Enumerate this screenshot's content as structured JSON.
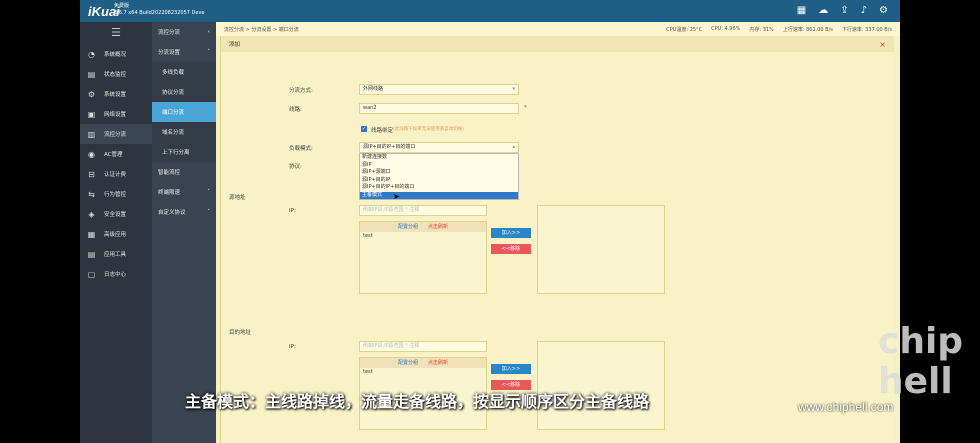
{
  "app": {
    "logo": "iKuai",
    "edition": "免费版",
    "version": "3.6.7 x64 Build202208232057 Deve"
  },
  "top_icons": [
    "grid-icon",
    "cloud-icon",
    "upload-icon",
    "bell-icon",
    "settings-icon"
  ],
  "sidebar": {
    "items": [
      {
        "icon": "dashboard-icon",
        "label": "系统概况"
      },
      {
        "icon": "monitor-icon",
        "label": "状态监控"
      },
      {
        "icon": "gear-icon",
        "label": "系统设置"
      },
      {
        "icon": "network-icon",
        "label": "网络设置"
      },
      {
        "icon": "flow-icon",
        "label": "流控分流"
      },
      {
        "icon": "ac-icon",
        "label": "AC管理"
      },
      {
        "icon": "auth-icon",
        "label": "认证计费"
      },
      {
        "icon": "behavior-icon",
        "label": "行为管控"
      },
      {
        "icon": "shield-icon",
        "label": "安全设置"
      },
      {
        "icon": "app-icon",
        "label": "高级应用"
      },
      {
        "icon": "tools-icon",
        "label": "应用工具"
      },
      {
        "icon": "log-icon",
        "label": "日志中心"
      }
    ]
  },
  "submenu": {
    "title": "流控分流",
    "group": "分流设置",
    "items": [
      "多线负载",
      "协议分流",
      "端口分流",
      "域名分流",
      "上下行分离"
    ],
    "selected": "端口分流",
    "extra": [
      "智能流控",
      "终端限速",
      "自定义协议"
    ]
  },
  "statusbar": {
    "breadcrumb": "流控分流 > 分流设置 > 端口分流",
    "cpu_temp": "CPU温度: 25°C",
    "cpu": "CPU: 4.96%",
    "mem": "内存: 31%",
    "up": "上行速率: 861.00 B/s",
    "down": "下行速率: 337.00 B/s"
  },
  "panel": {
    "title": "添加",
    "close": "×",
    "mode_label": "分流方式:",
    "mode_value": "外网线路",
    "line_label": "线路:",
    "line_value": "wan2",
    "line_mark": "*",
    "check_label": "线路绑定",
    "check_hint": "(此线路下如果无法使用则自动切换)",
    "load_label": "负载模式:",
    "load_value": "源IP+目的IP+目的端口",
    "proto_label": "协议:",
    "dropdown_options": [
      "新建连接数",
      "源IP",
      "源IP+源端口",
      "源IP+目的IP",
      "源IP+目的IP+目的端口",
      "主备模式"
    ],
    "dropdown_highlight": "主备模式",
    "src_section": "源地址",
    "dst_section": "目的地址",
    "ip_label": "IP:",
    "ip_placeholder": "例如IP段,IP段范围 * 注释",
    "box_config": "配置分组",
    "box_refresh": "点击刷新",
    "box_item": "test",
    "add_btn": "加入>>",
    "del_btn": "<<移除"
  },
  "overlay": {
    "subtitle": "主备模式：主线路掉线，流量走备线路，按显示顺序区分主备线路",
    "watermark": "chip hell",
    "site": "www.chiphell.com"
  }
}
